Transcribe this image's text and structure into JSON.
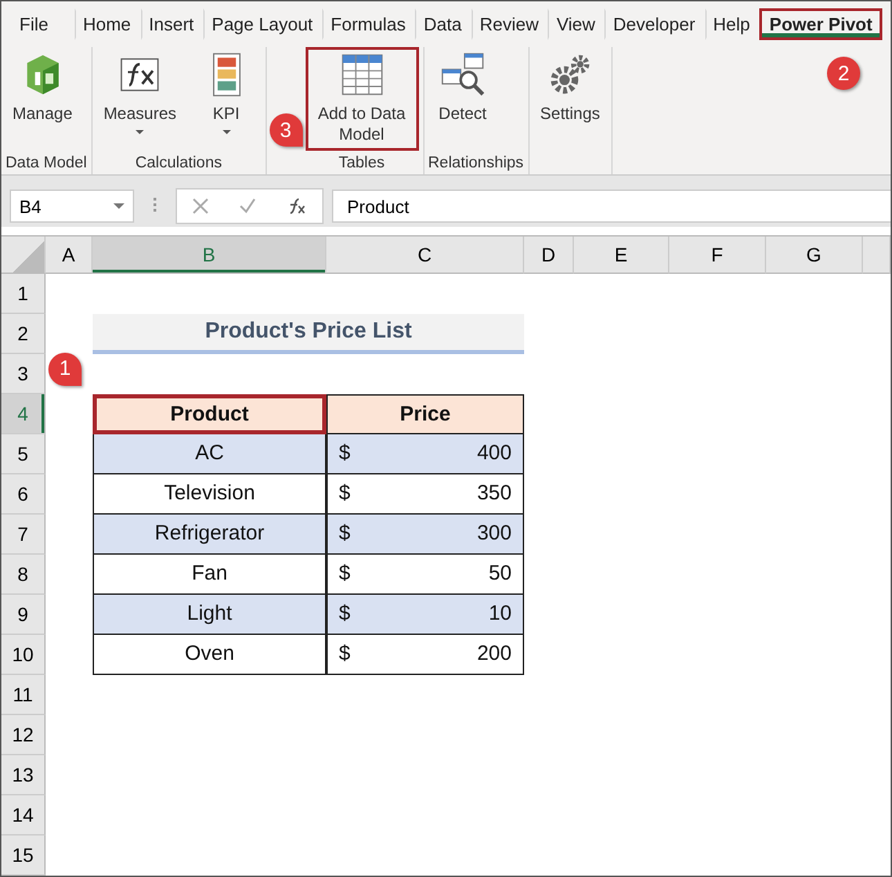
{
  "tabs": [
    {
      "label": "File",
      "selected": false,
      "highlighted": false
    },
    {
      "label": "Home",
      "selected": false,
      "highlighted": false
    },
    {
      "label": "Insert",
      "selected": false,
      "highlighted": false
    },
    {
      "label": "Page Layout",
      "selected": false,
      "highlighted": false
    },
    {
      "label": "Formulas",
      "selected": false,
      "highlighted": false
    },
    {
      "label": "Data",
      "selected": false,
      "highlighted": false
    },
    {
      "label": "Review",
      "selected": false,
      "highlighted": false
    },
    {
      "label": "View",
      "selected": false,
      "highlighted": false
    },
    {
      "label": "Developer",
      "selected": false,
      "highlighted": false
    },
    {
      "label": "Help",
      "selected": false,
      "highlighted": false
    },
    {
      "label": "Power Pivot",
      "selected": true,
      "highlighted": true,
      "callout": "2"
    }
  ],
  "ribbon_groups": [
    {
      "label": "Data Model",
      "buttons": [
        {
          "kind": "manage",
          "label": "Manage",
          "dropdown": false,
          "highlighted": false
        }
      ]
    },
    {
      "label": "Calculations",
      "buttons": [
        {
          "kind": "measures",
          "label": "Measures",
          "dropdown": true,
          "highlighted": false
        },
        {
          "kind": "kpi",
          "label": "KPI",
          "dropdown": true,
          "highlighted": false
        }
      ]
    },
    {
      "label": "Tables",
      "buttons": [
        {
          "kind": "table",
          "label": "Add to Data Model",
          "dropdown": false,
          "highlighted": true,
          "callout": "3"
        }
      ]
    },
    {
      "label": "Relationships",
      "buttons": [
        {
          "kind": "detect",
          "label": "Detect",
          "dropdown": false,
          "highlighted": false
        }
      ]
    },
    {
      "buttons": [
        {
          "kind": "settings",
          "label": "Settings",
          "dropdown": false,
          "highlighted": false
        }
      ]
    }
  ],
  "formula_bar": {
    "name_box": "B4",
    "value": "Product"
  },
  "sheet": {
    "columns": [
      {
        "letter": "A",
        "selected": false
      },
      {
        "letter": "B",
        "selected": true
      },
      {
        "letter": "C",
        "selected": false
      },
      {
        "letter": "D",
        "selected": false
      },
      {
        "letter": "E",
        "selected": false
      },
      {
        "letter": "F",
        "selected": false
      },
      {
        "letter": "G",
        "selected": false
      }
    ],
    "rows": [
      {
        "number": "1",
        "selected": false
      },
      {
        "number": "2",
        "selected": false
      },
      {
        "number": "3",
        "selected": false
      },
      {
        "number": "4",
        "selected": true
      },
      {
        "number": "5",
        "selected": false
      },
      {
        "number": "6",
        "selected": false
      },
      {
        "number": "7",
        "selected": false
      },
      {
        "number": "8",
        "selected": false
      },
      {
        "number": "9",
        "selected": false
      },
      {
        "number": "10",
        "selected": false
      },
      {
        "number": "11",
        "selected": false
      },
      {
        "number": "12",
        "selected": false
      },
      {
        "number": "13",
        "selected": false
      },
      {
        "number": "14",
        "selected": false
      },
      {
        "number": "15",
        "selected": false
      }
    ],
    "title": "Product's Price List",
    "table": {
      "header": [
        {
          "text": "Product",
          "highlighted": true,
          "callout": "1"
        },
        {
          "text": "Price",
          "highlighted": false
        }
      ],
      "rows": [
        {
          "product": "AC",
          "currency": "$",
          "price": "400",
          "shaded": true
        },
        {
          "product": "Television",
          "currency": "$",
          "price": "350",
          "shaded": false
        },
        {
          "product": "Refrigerator",
          "currency": "$",
          "price": "300",
          "shaded": true
        },
        {
          "product": "Fan",
          "currency": "$",
          "price": "50",
          "shaded": false
        },
        {
          "product": "Light",
          "currency": "$",
          "price": "10",
          "shaded": true
        },
        {
          "product": "Oven",
          "currency": "$",
          "price": "200",
          "shaded": false
        }
      ]
    }
  }
}
